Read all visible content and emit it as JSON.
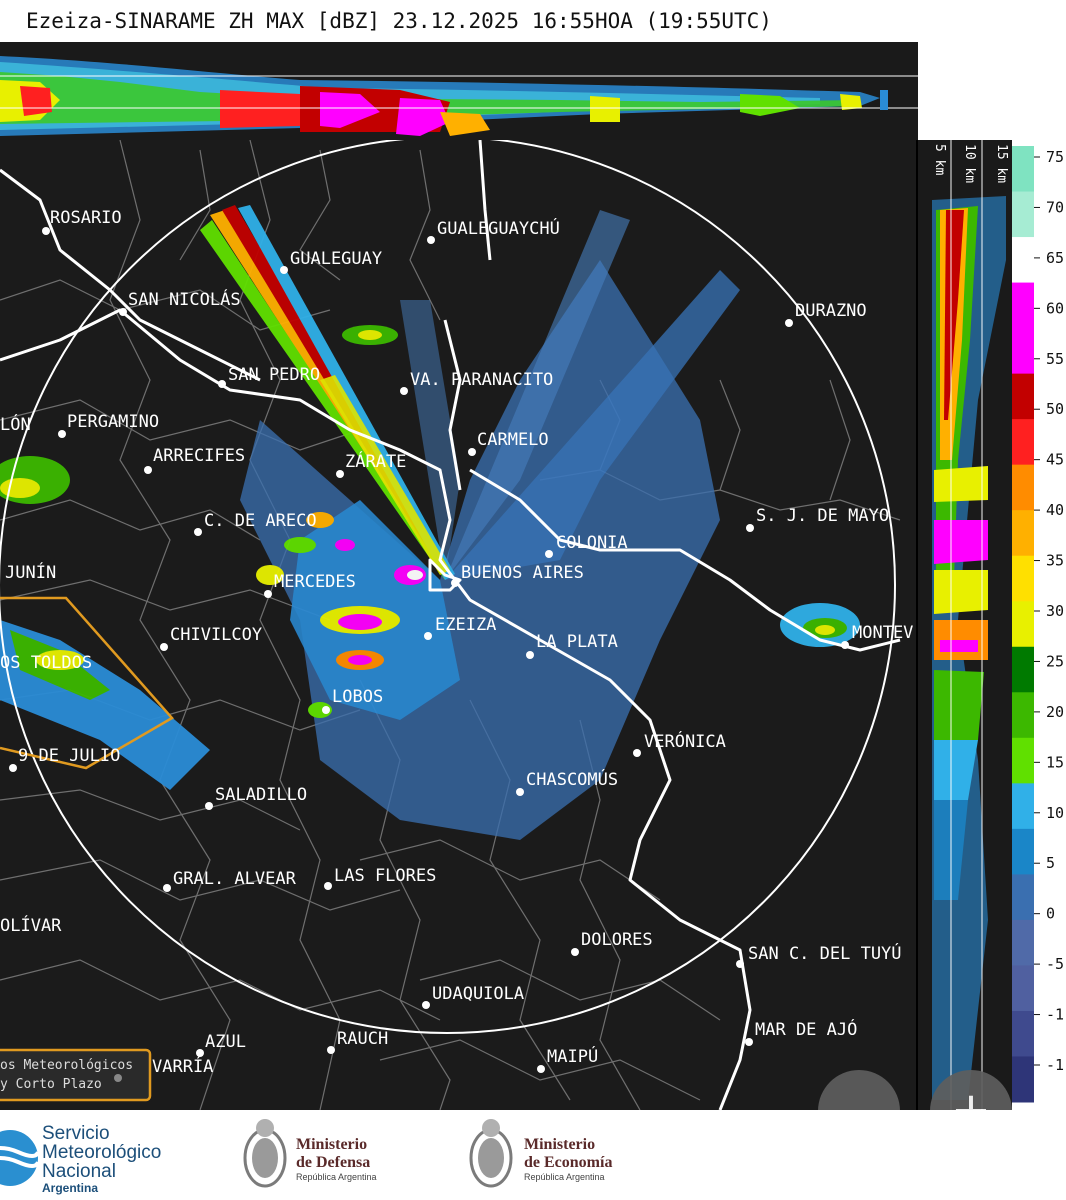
{
  "title": "Ezeiza-SINARAME ZH MAX [dBZ] 23.12.2025 16:55HOA (19:55UTC)",
  "map": {
    "cities": [
      {
        "name": "ROSARIO"
      },
      {
        "name": "GUALEGUAYCHÚ"
      },
      {
        "name": "GUALEGUAY"
      },
      {
        "name": "SAN NICOLÁS"
      },
      {
        "name": "DURAZNO"
      },
      {
        "name": "SAN PEDRO"
      },
      {
        "name": "VA. PARANACITO"
      },
      {
        "name": "LÓN"
      },
      {
        "name": "PERGAMINO"
      },
      {
        "name": "CARMELO"
      },
      {
        "name": "ARRECIFES"
      },
      {
        "name": "ZÁRATE"
      },
      {
        "name": "S. J. DE MAYO"
      },
      {
        "name": "C. DE ARECO"
      },
      {
        "name": "COLONIA"
      },
      {
        "name": "JUNÍN"
      },
      {
        "name": "BUENOS AIRES"
      },
      {
        "name": "MERCEDES"
      },
      {
        "name": "CHIVILCOY"
      },
      {
        "name": "EZEIZA"
      },
      {
        "name": "LA PLATA"
      },
      {
        "name": "MONTEV"
      },
      {
        "name": "OS TOLDOS"
      },
      {
        "name": "LOBOS"
      },
      {
        "name": "VERÓNICA"
      },
      {
        "name": "9 DE JULIO"
      },
      {
        "name": "CHASCOMÚS"
      },
      {
        "name": "SALADILLO"
      },
      {
        "name": "GRAL. ALVEAR"
      },
      {
        "name": "LAS FLORES"
      },
      {
        "name": "OLÍVAR"
      },
      {
        "name": "DOLORES"
      },
      {
        "name": "SAN C. DEL TUYÚ"
      },
      {
        "name": "UDAQUIOLA"
      },
      {
        "name": "MAR DE AJÓ"
      },
      {
        "name": "AZUL"
      },
      {
        "name": "RAUCH"
      },
      {
        "name": "VARRÍA"
      },
      {
        "name": "MAIPÚ"
      }
    ],
    "legend_box": {
      "line1": "os Meteorológicos",
      "line2": "y Corto Plazo"
    }
  },
  "side_strip": {
    "labels": [
      "5 km",
      "10 km",
      "15 km"
    ]
  },
  "colorbar": {
    "ticks": [
      "75",
      "70",
      "65",
      "60",
      "55",
      "50",
      "45",
      "40",
      "35",
      "30",
      "25",
      "20",
      "15",
      "10",
      "5",
      "0",
      "-5",
      "-1",
      "-1"
    ],
    "colors": [
      "#7fe3c1",
      "#a6ecd3",
      "#ffffff",
      "#ff00ff",
      "#ff00ff",
      "#c20000",
      "#ff2020",
      "#ff8c00",
      "#ffb000",
      "#ffe000",
      "#e8f000",
      "#007a00",
      "#3cb800",
      "#60e000",
      "#30b0e8",
      "#1a86c8",
      "#3a6fb0",
      "#506aa8",
      "#5060a0",
      "#3f4a8e",
      "#2e3578"
    ],
    "accent_colors": {
      "white": "#ffffff",
      "circle": "#ffffff",
      "coast": "#ffffff",
      "borders": "#8a8a8a",
      "polygon": "#e09a20"
    }
  },
  "footer": {
    "smn_line1": "Servicio",
    "smn_line2": "Meteorológico",
    "smn_line3": "Nacional",
    "smn_line4": "Argentina",
    "defensa_line1": "Ministerio",
    "defensa_line2": "de Defensa",
    "defensa_line3": "República Argentina",
    "economia_line1": "Ministerio",
    "economia_line2": "de Economía",
    "economia_line3": "República Argentina"
  },
  "controls": {
    "zoom_out": "-",
    "zoom_in": "+"
  }
}
